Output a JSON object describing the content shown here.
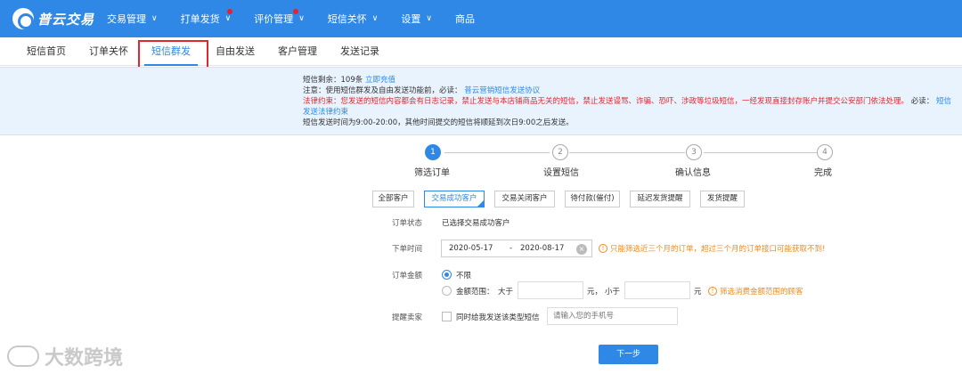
{
  "brand": {
    "name": "普云交易"
  },
  "topnav": {
    "items": [
      {
        "label": "交易管理",
        "chevron": true,
        "dot": false
      },
      {
        "label": "打单发货",
        "chevron": true,
        "dot": true
      },
      {
        "label": "评价管理",
        "chevron": true,
        "dot": true
      },
      {
        "label": "短信关怀",
        "chevron": true,
        "dot": false
      },
      {
        "label": "设置",
        "chevron": true,
        "dot": false
      },
      {
        "label": "商品",
        "chevron": false,
        "dot": false
      }
    ]
  },
  "subnav": {
    "tabs": [
      "短信首页",
      "订单关怀",
      "短信群发",
      "自由发送",
      "客户管理",
      "发送记录"
    ],
    "active": "短信群发"
  },
  "notice": {
    "balance_prefix": "短信剩余：109条",
    "recharge_link": "立即充值",
    "note_prefix": "注意：使用短信群发及自由发送功能前，必读：",
    "note_link": "普云营销短信发送协议",
    "law_red": "法律约束：您发送的短信内容都会有日志记录，禁止发送与本店铺商品无关的短信，禁止发送谩骂、诈骗、恐吓、涉政等垃圾短信，一经发现直接封存账户并提交公安部门依法处理。",
    "law_suffix": "必读：",
    "law_link": "短信发送法律约束",
    "time_note": "短信发送时间为9:00-20:00，其他时间提交的短信将顺延到次日9:00之后发送。"
  },
  "steps": [
    {
      "num": "1",
      "label": "筛选订单",
      "done": true
    },
    {
      "num": "2",
      "label": "设置短信",
      "done": false
    },
    {
      "num": "3",
      "label": "确认信息",
      "done": false
    },
    {
      "num": "4",
      "label": "完成",
      "done": false
    }
  ],
  "filters": {
    "buttons": [
      "全部客户",
      "交易成功客户",
      "交易关闭客户",
      "待付款(催付)",
      "延迟发货提醒",
      "发货提醒"
    ],
    "active": "交易成功客户"
  },
  "form": {
    "status_label": "订单状态",
    "status_value": "已选择交易成功客户",
    "time_label": "下单时间",
    "date_start": "2020-05-17",
    "date_sep": "-",
    "date_end": "2020-08-17",
    "time_warning": "只能筛选近三个月的订单，超过三个月的订单接口可能获取不到!",
    "amount_label": "订单金额",
    "unlimited_option": "不限",
    "range_option": "金额范围：",
    "greater_than": "大于",
    "yuan1": "元，",
    "less_than": "小于",
    "yuan2": "元",
    "range_tip": "筛选消费金额范围的顾客",
    "remind_label": "提醒卖家",
    "remind_checkbox_label": "同时给我发送该类型短信",
    "phone_placeholder": "请输入您的手机号",
    "next_button": "下一步"
  },
  "watermark": {
    "text": "大数跨境"
  },
  "colors": {
    "primary": "#2f88e6",
    "highlight": "#e0262f",
    "warning": "#f08a19",
    "notice_bg": "#e8f3fe"
  }
}
